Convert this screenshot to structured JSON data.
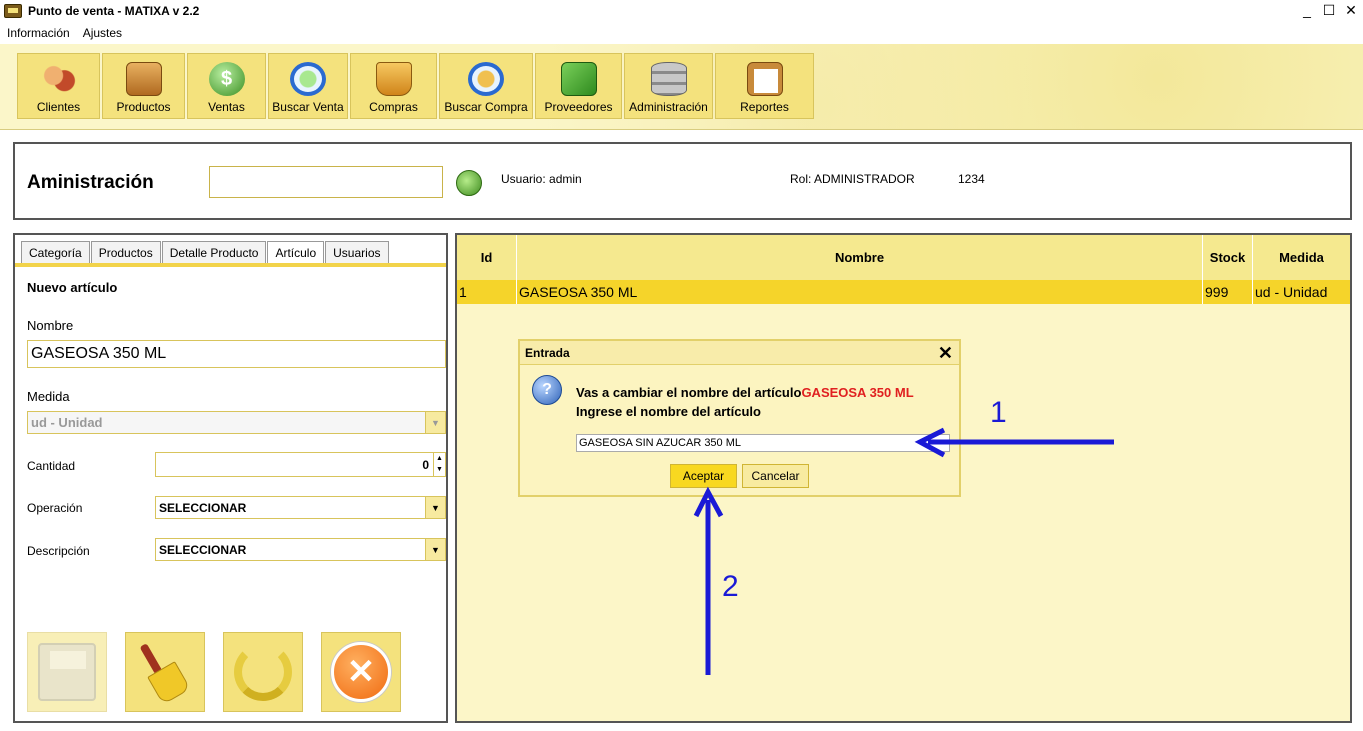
{
  "window": {
    "title": "Punto de venta - MATIXA v 2.2",
    "controls": [
      "_",
      "☐",
      "✕"
    ]
  },
  "menu": [
    "Información",
    "Ajustes"
  ],
  "toolbar": [
    {
      "label": "Clientes",
      "icon": "clients-icon",
      "color": "#c87a3a"
    },
    {
      "label": "Productos",
      "icon": "box-icon",
      "color": "#d89a4a"
    },
    {
      "label": "Ventas",
      "icon": "dollar-icon",
      "color": "#5aa83a"
    },
    {
      "label": "Buscar Venta",
      "icon": "search-dollar-icon",
      "color": "#3a7ad8"
    },
    {
      "label": "Compras",
      "icon": "basket-icon",
      "color": "#e0a030"
    },
    {
      "label": "Buscar Compra",
      "icon": "search-box-icon",
      "color": "#3a7ad8"
    },
    {
      "label": "Proveedores",
      "icon": "supplier-icon",
      "color": "#3aa83a"
    },
    {
      "label": "Administración",
      "icon": "database-icon",
      "color": "#9a9a9a"
    },
    {
      "label": "Reportes",
      "icon": "clipboard-icon",
      "color": "#c88a3a"
    }
  ],
  "header": {
    "title": "Aministración",
    "search_value": "",
    "user": "Usuario: admin",
    "role": "Rol: ADMINISTRADOR",
    "code": "1234"
  },
  "tabs": [
    "Categoría",
    "Productos",
    "Detalle Producto",
    "Artículo",
    "Usuarios"
  ],
  "form": {
    "title": "Nuevo artículo",
    "nombre_label": "Nombre",
    "nombre_value": "GASEOSA 350 ML",
    "medida_label": "Medida",
    "medida_value": "ud - Unidad",
    "cantidad_label": "Cantidad",
    "cantidad_value": "0",
    "operacion_label": "Operación",
    "operacion_value": "SELECCIONAR",
    "descripcion_label": "Descripción",
    "descripcion_value": "SELECCIONAR"
  },
  "table": {
    "columns": [
      "Id",
      "Nombre",
      "Stock",
      "Medida"
    ],
    "rows": [
      {
        "id": "1",
        "nombre": "GASEOSA 350 ML",
        "stock": "999",
        "medida": "ud - Unidad"
      }
    ]
  },
  "dialog": {
    "title": "Entrada",
    "close": "✕",
    "icon_text": "?",
    "msg_line1": "Vas a cambiar el nombre del artículo",
    "msg_highlight": "GASEOSA 350 ML",
    "msg_line2": "Ingrese el nombre del artículo",
    "input_value": "GASEOSA SIN AZUCAR 350 ML",
    "ok": "Aceptar",
    "cancel": "Cancelar"
  },
  "annotations": {
    "one": "1",
    "two": "2",
    "color": "#1a1ad6"
  }
}
